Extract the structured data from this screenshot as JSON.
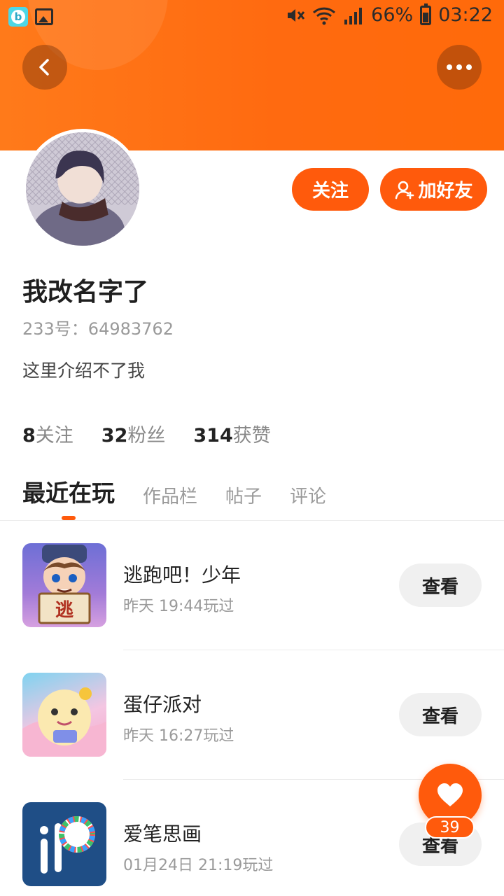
{
  "status_bar": {
    "battery": "66%",
    "time": "03:22",
    "network": "4G"
  },
  "header": {
    "back_icon": "back-chevron-icon",
    "more_icon": "more-dots-icon",
    "gradient_color": "#ff6a10"
  },
  "profile": {
    "follow_label": "关注",
    "add_friend_label": "加好友",
    "username": "我改名字了",
    "user_id": "233号：64983762",
    "bio": "这里介绍不了我",
    "stats": [
      {
        "count": "8",
        "label": "关注"
      },
      {
        "count": "32",
        "label": "粉丝"
      },
      {
        "count": "314",
        "label": "获赞"
      }
    ]
  },
  "tabs": [
    {
      "label": "最近在玩",
      "active": true
    },
    {
      "label": "作品栏",
      "active": false
    },
    {
      "label": "帖子",
      "active": false
    },
    {
      "label": "评论",
      "active": false
    }
  ],
  "games": [
    {
      "title": "逃跑吧！少年",
      "time": "昨天 19:44玩过",
      "button": "查看",
      "icon_text": "逃"
    },
    {
      "title": "蛋仔派对",
      "time": "昨天 16:27玩过",
      "button": "查看"
    },
    {
      "title": "爱笔思画",
      "time": "01月24日 21:19玩过",
      "button": "查看"
    }
  ],
  "like": {
    "count": "39",
    "icon": "heart-icon"
  },
  "colors": {
    "accent": "#ff5a0c",
    "header": "#ff7a1a"
  }
}
